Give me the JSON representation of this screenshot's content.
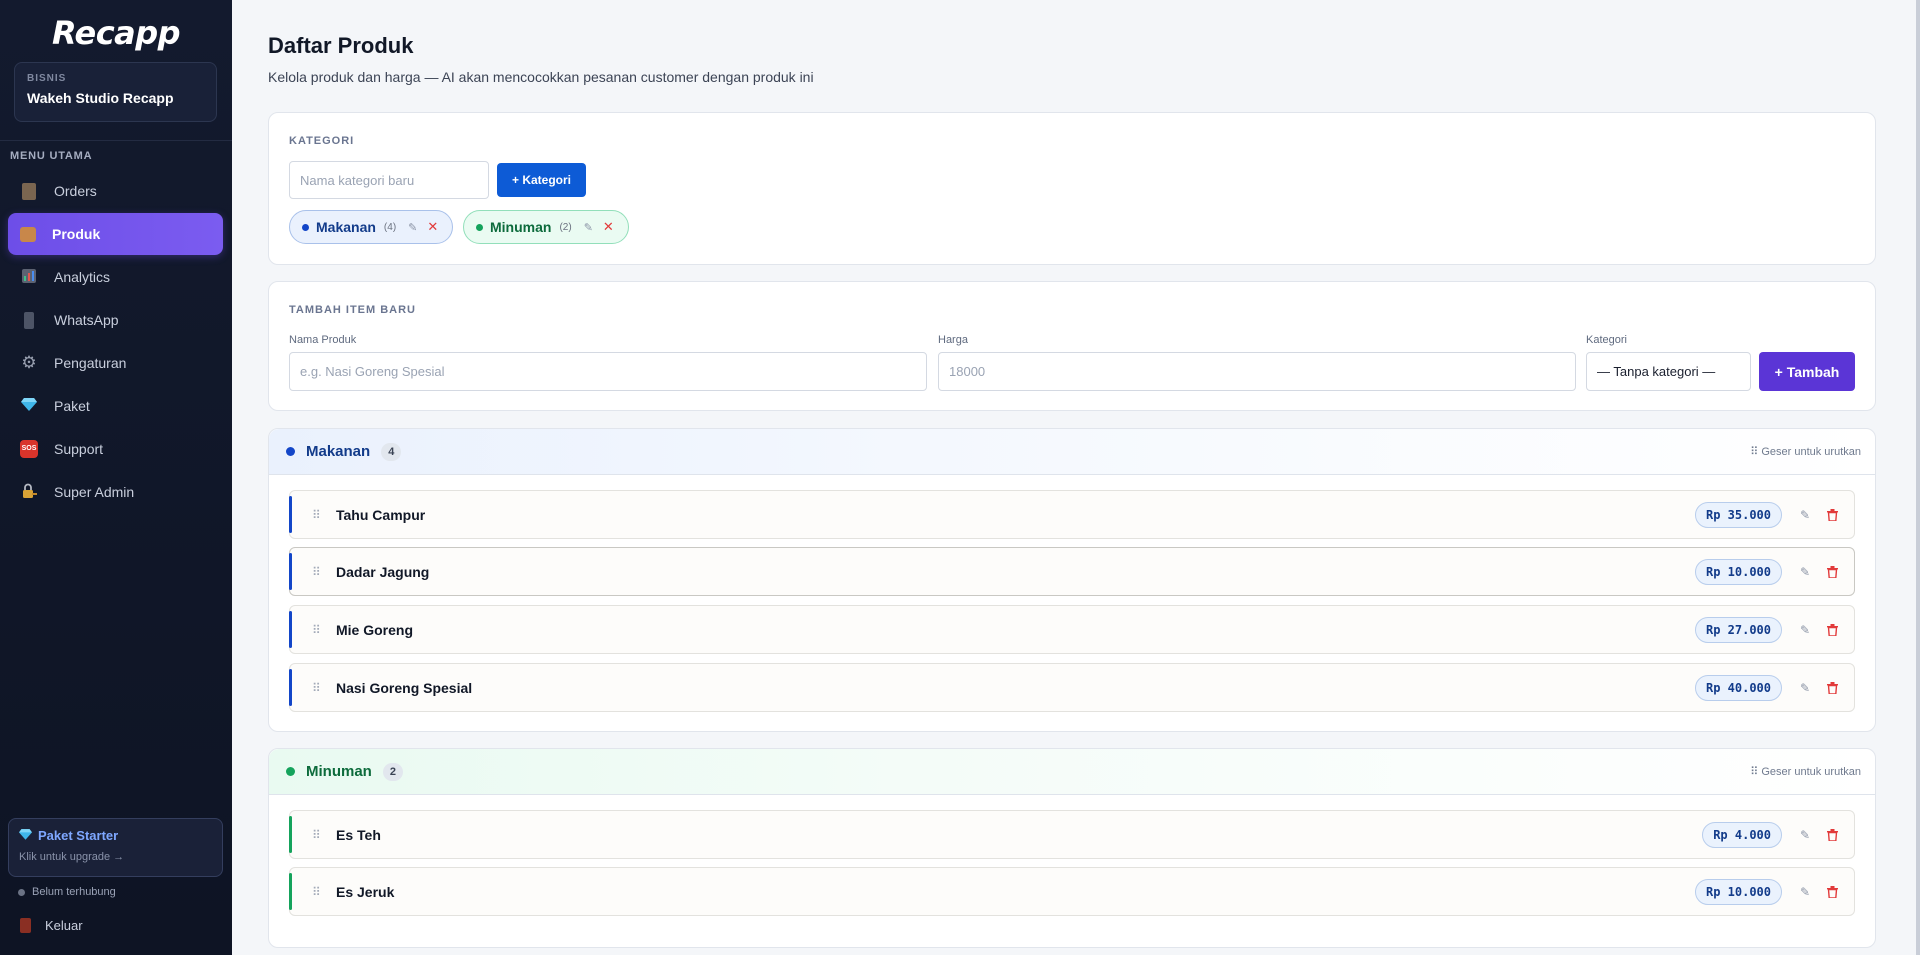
{
  "sidebar": {
    "logo": "Recapp",
    "business_label": "BISNIS",
    "business_name": "Wakeh Studio Recapp",
    "menu_label": "MENU UTAMA",
    "items": [
      {
        "label": "Orders",
        "icon": "clipboard-icon"
      },
      {
        "label": "Produk",
        "icon": "package-icon",
        "active": true
      },
      {
        "label": "Analytics",
        "icon": "bar-chart-icon"
      },
      {
        "label": "WhatsApp",
        "icon": "phone-icon"
      },
      {
        "label": "Pengaturan",
        "icon": "gear-icon"
      },
      {
        "label": "Paket",
        "icon": "gem-icon"
      },
      {
        "label": "Support",
        "icon": "sos-icon"
      },
      {
        "label": "Super Admin",
        "icon": "lock-key-icon"
      }
    ],
    "plan_title": "Paket Starter",
    "plan_sub": "Klik untuk upgrade →",
    "connection": "Belum terhubung",
    "logout": "Keluar"
  },
  "page": {
    "title": "Daftar Produk",
    "subtitle": "Kelola produk dan harga — AI akan mencocokkan pesanan customer dengan produk ini"
  },
  "categories": {
    "label": "KATEGORI",
    "input_placeholder": "Nama kategori baru",
    "add_label": "+ Kategori",
    "chips": [
      {
        "name": "Makanan",
        "count": "(4)"
      },
      {
        "name": "Minuman",
        "count": "(2)"
      }
    ]
  },
  "add_item": {
    "label": "TAMBAH ITEM BARU",
    "name_label": "Nama Produk",
    "name_placeholder": "e.g. Nasi Goreng Spesial",
    "price_label": "Harga",
    "price_placeholder": "18000",
    "category_label": "Kategori",
    "category_value": "— Tanpa kategori —",
    "submit_label": "+ Tambah"
  },
  "groups": [
    {
      "name": "Makanan",
      "count": "4",
      "hint": "⠿ Geser untuk urutkan",
      "items": [
        {
          "name": "Tahu Campur",
          "price": "Rp 35.000"
        },
        {
          "name": "Dadar Jagung",
          "price": "Rp 10.000"
        },
        {
          "name": "Mie Goreng",
          "price": "Rp 27.000"
        },
        {
          "name": "Nasi Goreng Spesial",
          "price": "Rp 40.000"
        }
      ]
    },
    {
      "name": "Minuman",
      "count": "2",
      "hint": "⠿ Geser untuk urutkan",
      "items": [
        {
          "name": "Es Teh",
          "price": "Rp 4.000"
        },
        {
          "name": "Es Jeruk",
          "price": "Rp 10.000"
        }
      ]
    }
  ],
  "colors": {
    "accent_purple": "#5b35d6",
    "accent_blue": "#0d5bd6",
    "makanan": "#1346c8",
    "minuman": "#15a35c",
    "danger": "#e23a3a"
  }
}
